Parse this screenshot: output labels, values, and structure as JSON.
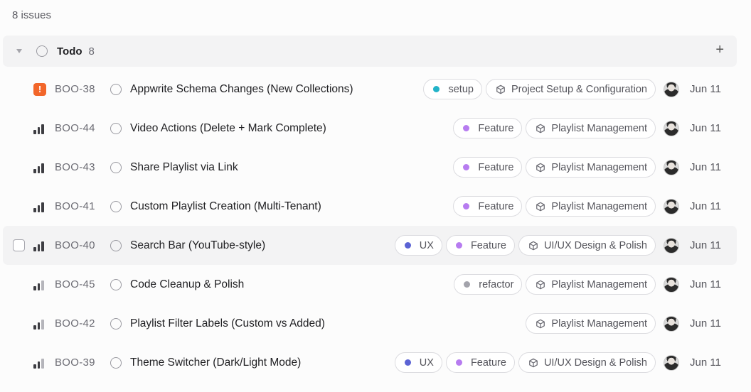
{
  "summary": "8 issues",
  "group": {
    "title": "Todo",
    "count": "8",
    "add_label": "+"
  },
  "colors": {
    "urgent": "#f2662a",
    "setup": "#22b3c8",
    "feature": "#b77cf0",
    "ux": "#5b63d4",
    "refactor": "#a3a3ab"
  },
  "issues": [
    {
      "priority": "urgent",
      "id": "BOO-38",
      "title": "Appwrite Schema Changes (New Collections)",
      "labels": [
        {
          "name": "setup",
          "color": "#22b3c8"
        }
      ],
      "project": "Project Setup & Configuration",
      "date": "Jun 11"
    },
    {
      "priority": "high",
      "id": "BOO-44",
      "title": "Video Actions (Delete + Mark Complete)",
      "labels": [
        {
          "name": "Feature",
          "color": "#b77cf0"
        }
      ],
      "project": "Playlist Management",
      "date": "Jun 11"
    },
    {
      "priority": "high",
      "id": "BOO-43",
      "title": "Share Playlist via Link",
      "labels": [
        {
          "name": "Feature",
          "color": "#b77cf0"
        }
      ],
      "project": "Playlist Management",
      "date": "Jun 11"
    },
    {
      "priority": "high",
      "id": "BOO-41",
      "title": "Custom Playlist Creation (Multi-Tenant)",
      "labels": [
        {
          "name": "Feature",
          "color": "#b77cf0"
        }
      ],
      "project": "Playlist Management",
      "date": "Jun 11"
    },
    {
      "priority": "high",
      "id": "BOO-40",
      "title": "Search Bar (YouTube-style)",
      "labels": [
        {
          "name": "UX",
          "color": "#5b63d4"
        },
        {
          "name": "Feature",
          "color": "#b77cf0"
        }
      ],
      "project": "UI/UX Design & Polish",
      "date": "Jun 11",
      "hover": true
    },
    {
      "priority": "medium",
      "id": "BOO-45",
      "title": "Code Cleanup & Polish",
      "labels": [
        {
          "name": "refactor",
          "color": "#a3a3ab"
        }
      ],
      "project": "Playlist Management",
      "date": "Jun 11"
    },
    {
      "priority": "medium",
      "id": "BOO-42",
      "title": "Playlist Filter Labels (Custom vs Added)",
      "labels": [],
      "project": "Playlist Management",
      "date": "Jun 11"
    },
    {
      "priority": "medium",
      "id": "BOO-39",
      "title": "Theme Switcher (Dark/Light Mode)",
      "labels": [
        {
          "name": "UX",
          "color": "#5b63d4"
        },
        {
          "name": "Feature",
          "color": "#b77cf0"
        }
      ],
      "project": "UI/UX Design & Polish",
      "date": "Jun 11"
    }
  ]
}
